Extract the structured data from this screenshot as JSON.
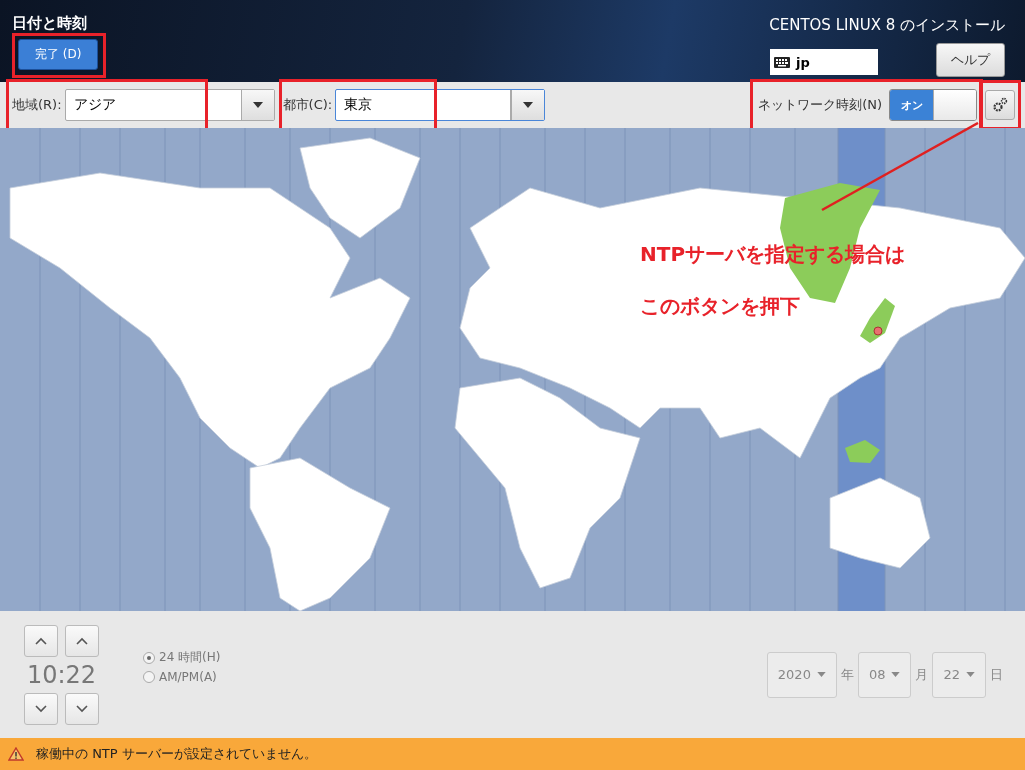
{
  "header": {
    "title": "日付と時刻",
    "done_button": "完了 (D)",
    "product": "CENTOS LINUX 8 のインストール",
    "keyboard_layout": "jp",
    "help_button": "ヘルプ"
  },
  "toolbar": {
    "region": {
      "label": "地域(R):",
      "value": "アジア"
    },
    "city": {
      "label": "都市(C):",
      "value": "東京"
    },
    "network_time": {
      "label": "ネットワーク時刻(N)",
      "on": true,
      "on_label": "オン"
    }
  },
  "annotation": {
    "lines": [
      "NTPサーバを指定する場合は",
      "このボタンを押下"
    ]
  },
  "time": {
    "value": "10:22"
  },
  "time_format": [
    {
      "label": "24 時間(H)",
      "selected": true
    },
    {
      "label": "AM/PM(A)",
      "selected": false
    }
  ],
  "date": {
    "year": "2020",
    "year_unit": "年",
    "month": "08",
    "month_unit": "月",
    "day": "22",
    "day_unit": "日"
  },
  "status_bar": {
    "message": "稼働中の NTP サーバーが設定されていません。"
  }
}
